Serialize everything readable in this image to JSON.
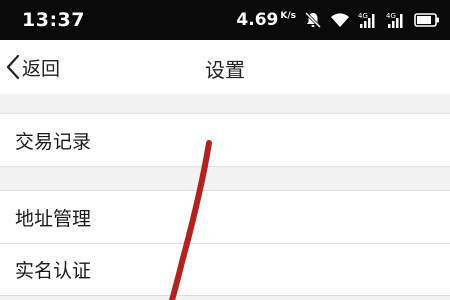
{
  "status_bar": {
    "time": "13:37",
    "network_speed": "4.69",
    "network_speed_unit": "K/s",
    "signal_label_1": "4G",
    "signal_label_2": "4G"
  },
  "nav": {
    "back_label": "返回",
    "title": "设置"
  },
  "sections": [
    {
      "items": [
        {
          "label": "交易记录"
        }
      ]
    },
    {
      "items": [
        {
          "label": "地址管理"
        },
        {
          "label": "实名认证"
        }
      ]
    }
  ],
  "colors": {
    "annotation": "#b3231d",
    "status_bar_bg": "#0a0a0a",
    "page_bg": "#f2f2f2"
  }
}
